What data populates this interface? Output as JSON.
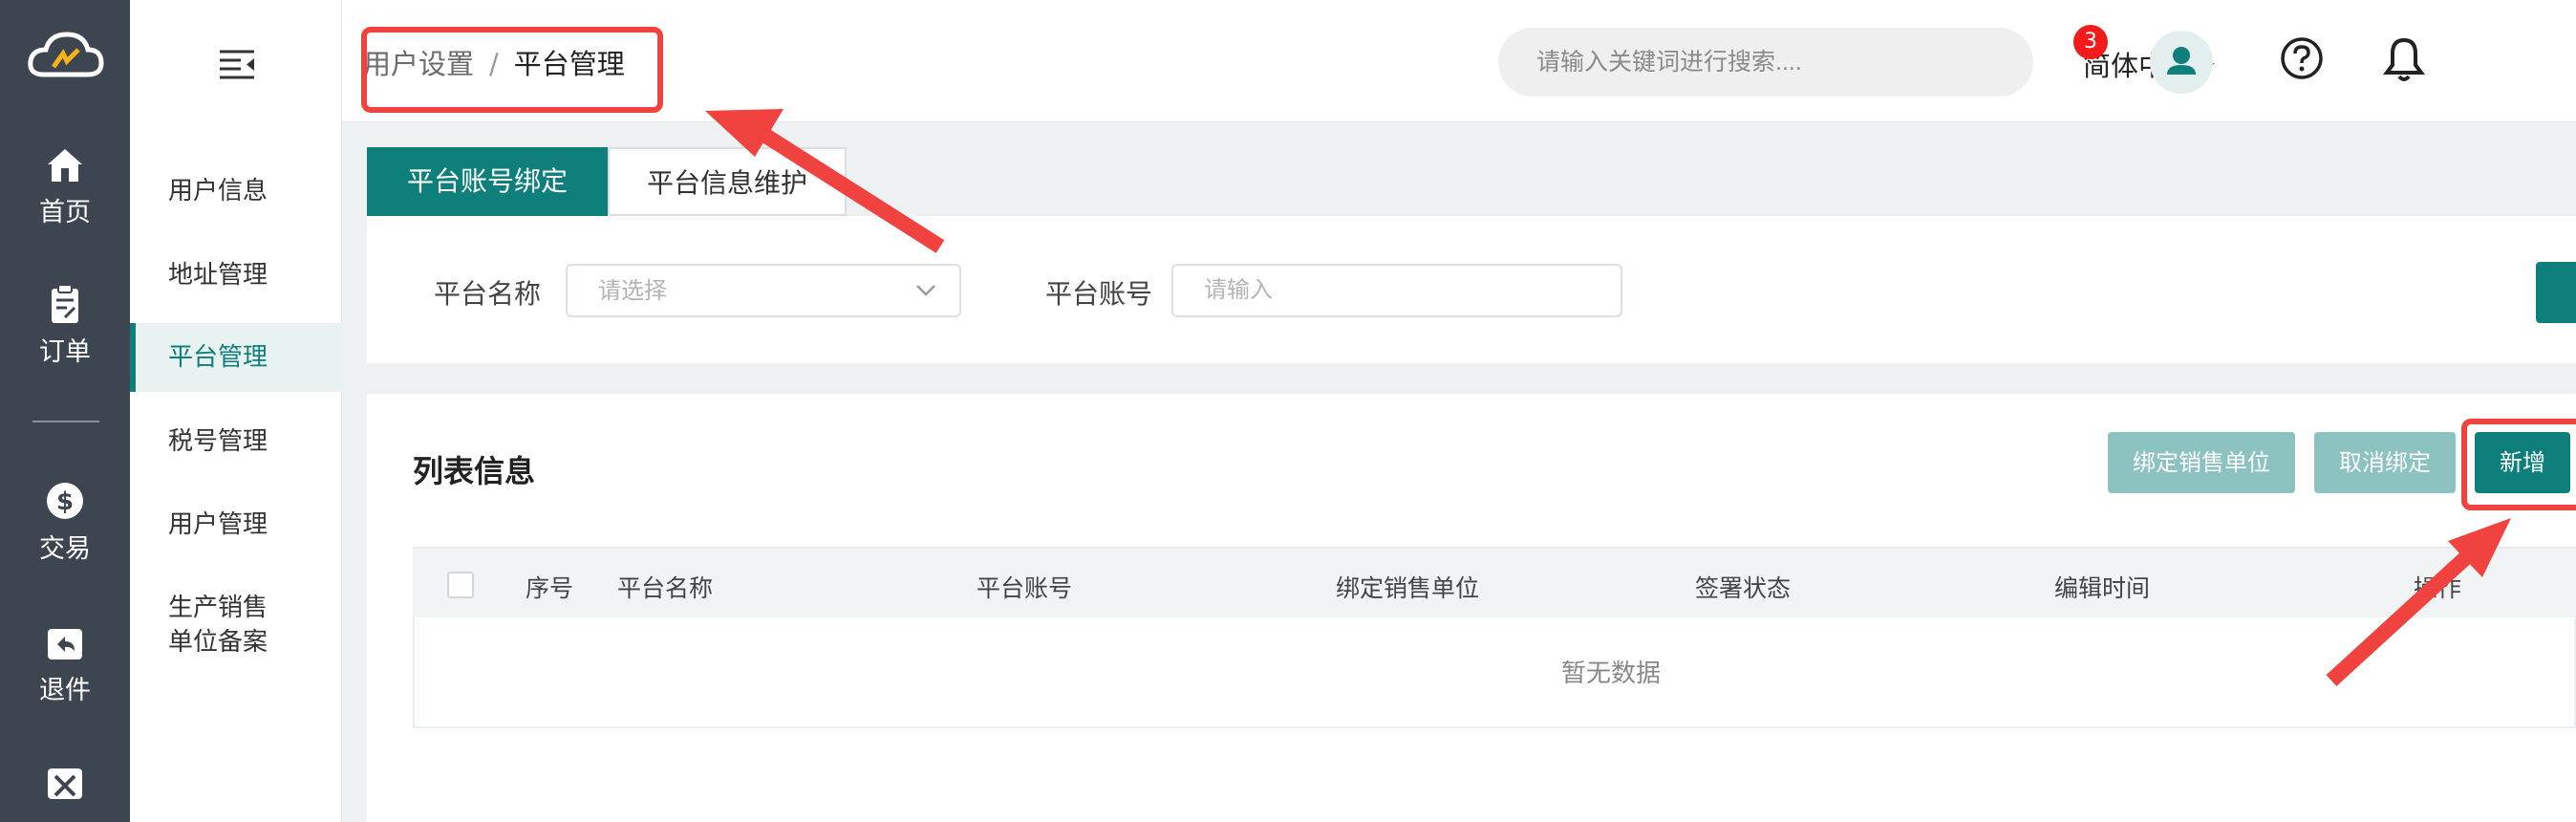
{
  "rail": {
    "items": [
      {
        "label": "首页",
        "icon": "home-icon"
      },
      {
        "label": "订单",
        "icon": "clipboard-icon"
      },
      {
        "label": "交易",
        "icon": "dollar-icon"
      },
      {
        "label": "退件",
        "icon": "return-box-icon"
      },
      {
        "label": "",
        "icon": "tools-box-icon"
      }
    ]
  },
  "submenu": {
    "items": [
      {
        "label": "用户信息"
      },
      {
        "label": "地址管理"
      },
      {
        "label": "平台管理"
      },
      {
        "label": "税号管理"
      },
      {
        "label": "用户管理"
      },
      {
        "label": "生产销售"
      },
      {
        "label": "单位备案"
      }
    ]
  },
  "header": {
    "breadcrumb": [
      "用户设置",
      "/",
      "平台管理"
    ],
    "search_placeholder": "请输入关键词进行搜索....",
    "language": "简体中文",
    "notification_count": "3"
  },
  "tabs": [
    {
      "label": "平台账号绑定",
      "active": true
    },
    {
      "label": "平台信息维护",
      "active": false
    }
  ],
  "filter": {
    "platform_name_label": "平台名称",
    "platform_name_placeholder": "请选择",
    "platform_account_label": "平台账号",
    "platform_account_placeholder": "请输入"
  },
  "list": {
    "title": "列表信息",
    "buttons": {
      "bind": "绑定销售单位",
      "unbind": "取消绑定",
      "add": "新增"
    },
    "columns": [
      "序号",
      "平台名称",
      "平台账号",
      "绑定销售单位",
      "签署状态",
      "编辑时间",
      "操作"
    ],
    "empty_text": "暂无数据"
  },
  "colors": {
    "accent": "#0e7f7b",
    "accent_light": "#8cc2c0",
    "annotation": "#f0423f",
    "rail_bg": "#3d4550"
  }
}
